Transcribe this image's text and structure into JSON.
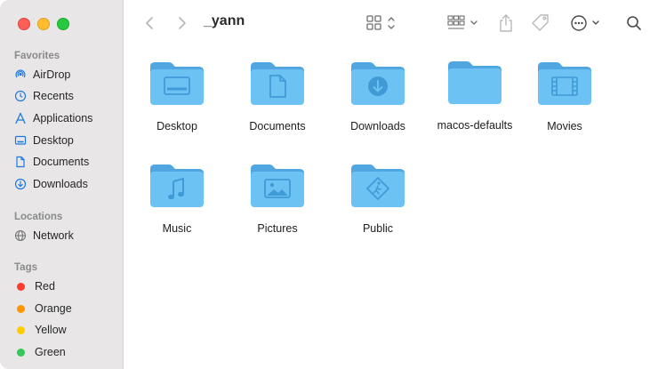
{
  "window": {
    "title": "_yann"
  },
  "sidebar": {
    "favorites_title": "Favorites",
    "favorites": [
      {
        "label": "AirDrop",
        "icon": "airdrop-icon"
      },
      {
        "label": "Recents",
        "icon": "clock-icon"
      },
      {
        "label": "Applications",
        "icon": "applications-icon"
      },
      {
        "label": "Desktop",
        "icon": "desktop-icon"
      },
      {
        "label": "Documents",
        "icon": "document-icon"
      },
      {
        "label": "Downloads",
        "icon": "download-icon"
      }
    ],
    "locations_title": "Locations",
    "locations": [
      {
        "label": "Network",
        "icon": "globe-icon"
      }
    ],
    "tags_title": "Tags",
    "tags": [
      {
        "label": "Red",
        "color": "#ff3b30"
      },
      {
        "label": "Orange",
        "color": "#ff9500"
      },
      {
        "label": "Yellow",
        "color": "#ffcc00"
      },
      {
        "label": "Green",
        "color": "#34c759"
      }
    ]
  },
  "folders": [
    {
      "label": "Desktop",
      "glyph": "desktop-glyph"
    },
    {
      "label": "Documents",
      "glyph": "document-glyph"
    },
    {
      "label": "Downloads",
      "glyph": "download-glyph"
    },
    {
      "label": "macos-defaults",
      "glyph": "none"
    },
    {
      "label": "Movies",
      "glyph": "film-glyph"
    },
    {
      "label": "Music",
      "glyph": "music-glyph"
    },
    {
      "label": "Pictures",
      "glyph": "picture-glyph"
    },
    {
      "label": "Public",
      "glyph": "public-glyph"
    }
  ],
  "colors": {
    "folder_body": "#6cc3f3",
    "folder_tab": "#4fa6e0",
    "folder_glyph": "#3f9ad6",
    "sidebar_bg": "#e8e6e6"
  }
}
